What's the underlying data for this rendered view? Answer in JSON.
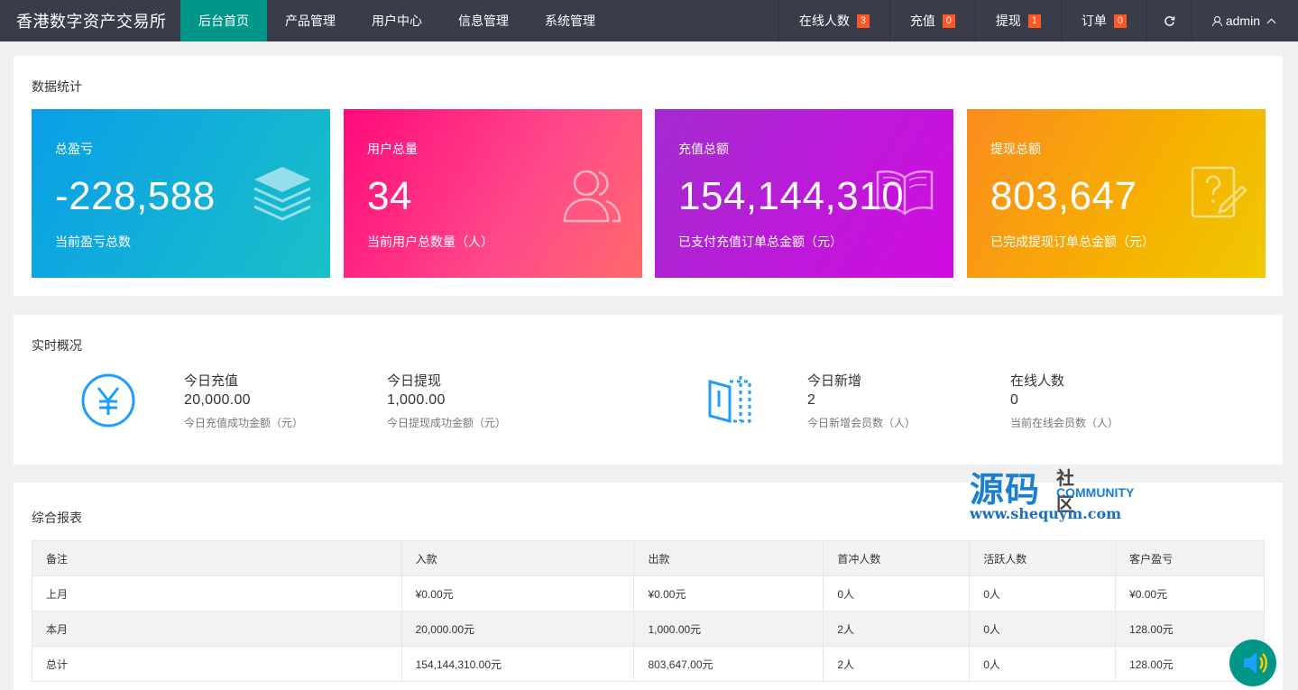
{
  "brand": "香港数字资产交易所",
  "nav": [
    "后台首页",
    "产品管理",
    "用户中心",
    "信息管理",
    "系统管理"
  ],
  "right": {
    "online": {
      "label": "在线人数",
      "count": "3"
    },
    "recharge": {
      "label": "充值",
      "count": "0"
    },
    "withdraw": {
      "label": "提现",
      "count": "1"
    },
    "orders": {
      "label": "订单",
      "count": "0"
    },
    "user": "admin"
  },
  "stats": {
    "title": "数据统计",
    "cards": [
      {
        "label": "总盈亏",
        "value": "-228,588",
        "desc": "当前盈亏总数",
        "icon": "layers-icon"
      },
      {
        "label": "用户总量",
        "value": "34",
        "desc": "当前用户总数量（人）",
        "icon": "users-icon"
      },
      {
        "label": "充值总额",
        "value": "154,144,310",
        "desc": "已支付充值订单总金额（元）",
        "icon": "book-icon"
      },
      {
        "label": "提现总额",
        "value": "803,647",
        "desc": "已完成提现订单总金额（元）",
        "icon": "help-icon"
      }
    ]
  },
  "realtime": {
    "title": "实时概况",
    "items": [
      {
        "label": "今日充值",
        "value": "20,000.00",
        "desc": "今日充值成功金额（元）"
      },
      {
        "label": "今日提现",
        "value": "1,000.00",
        "desc": "今日提现成功金额（元）"
      },
      {
        "label": "今日新增",
        "value": "2",
        "desc": "今日新增会员数（人）"
      },
      {
        "label": "在线人数",
        "value": "0",
        "desc": "当前在线会员数（人）"
      }
    ]
  },
  "report": {
    "title": "综合报表",
    "headers": [
      "备注",
      "入款",
      "出款",
      "首冲人数",
      "活跃人数",
      "客户盈亏"
    ],
    "rows": [
      [
        "上月",
        "¥0.00元",
        "¥0.00元",
        "0人",
        "0人",
        "¥0.00元"
      ],
      [
        "本月",
        "20,000.00元",
        "1,000.00元",
        "2人",
        "0人",
        "128.00元"
      ],
      [
        "总计",
        "154,144,310.00元",
        "803,647.00元",
        "2人",
        "0人",
        "128.00元"
      ]
    ]
  },
  "watermark": {
    "main": "源码",
    "sub": "社区",
    "community": "COMMUNITY",
    "url": "www.shequym.com"
  }
}
